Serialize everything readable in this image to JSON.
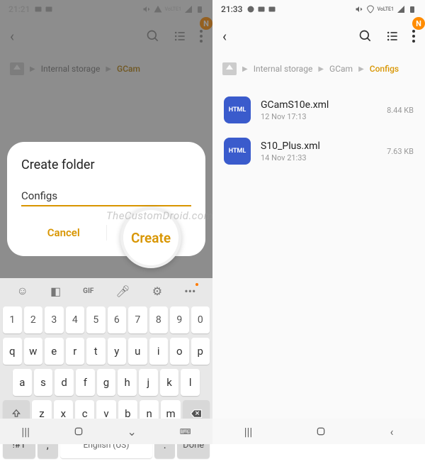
{
  "left": {
    "status": {
      "time": "21:21"
    },
    "crumbs": [
      "Internal storage",
      "GCam"
    ],
    "badge": "N",
    "dialog": {
      "title": "Create folder",
      "value": "Configs",
      "cancel": "Cancel",
      "create": "Create"
    },
    "keyboard": {
      "row1": [
        "1",
        "2",
        "3",
        "4",
        "5",
        "6",
        "7",
        "8",
        "9",
        "0"
      ],
      "row2": [
        "q",
        "w",
        "e",
        "r",
        "t",
        "y",
        "u",
        "i",
        "o",
        "p"
      ],
      "row3": [
        "a",
        "s",
        "d",
        "f",
        "g",
        "h",
        "j",
        "k",
        "l"
      ],
      "row4": [
        "z",
        "x",
        "c",
        "v",
        "b",
        "n",
        "m"
      ],
      "sym": "!#1",
      "lang": "English (US)",
      "comma": ",",
      "period": ".",
      "done": "Done"
    }
  },
  "right": {
    "status": {
      "time": "21:33"
    },
    "crumbs": [
      "Internal storage",
      "GCam",
      "Configs"
    ],
    "badge": "N",
    "files": [
      {
        "name": "GCamS10e.xml",
        "date": "12 Nov 17:13",
        "size": "8.44 KB",
        "type": "HTML"
      },
      {
        "name": "S10_Plus.xml",
        "date": "14 Nov 21:33",
        "size": "7.63 KB",
        "type": "HTML"
      }
    ]
  },
  "watermark": "TheCustomDroid.com",
  "lte": "VoLTE1"
}
